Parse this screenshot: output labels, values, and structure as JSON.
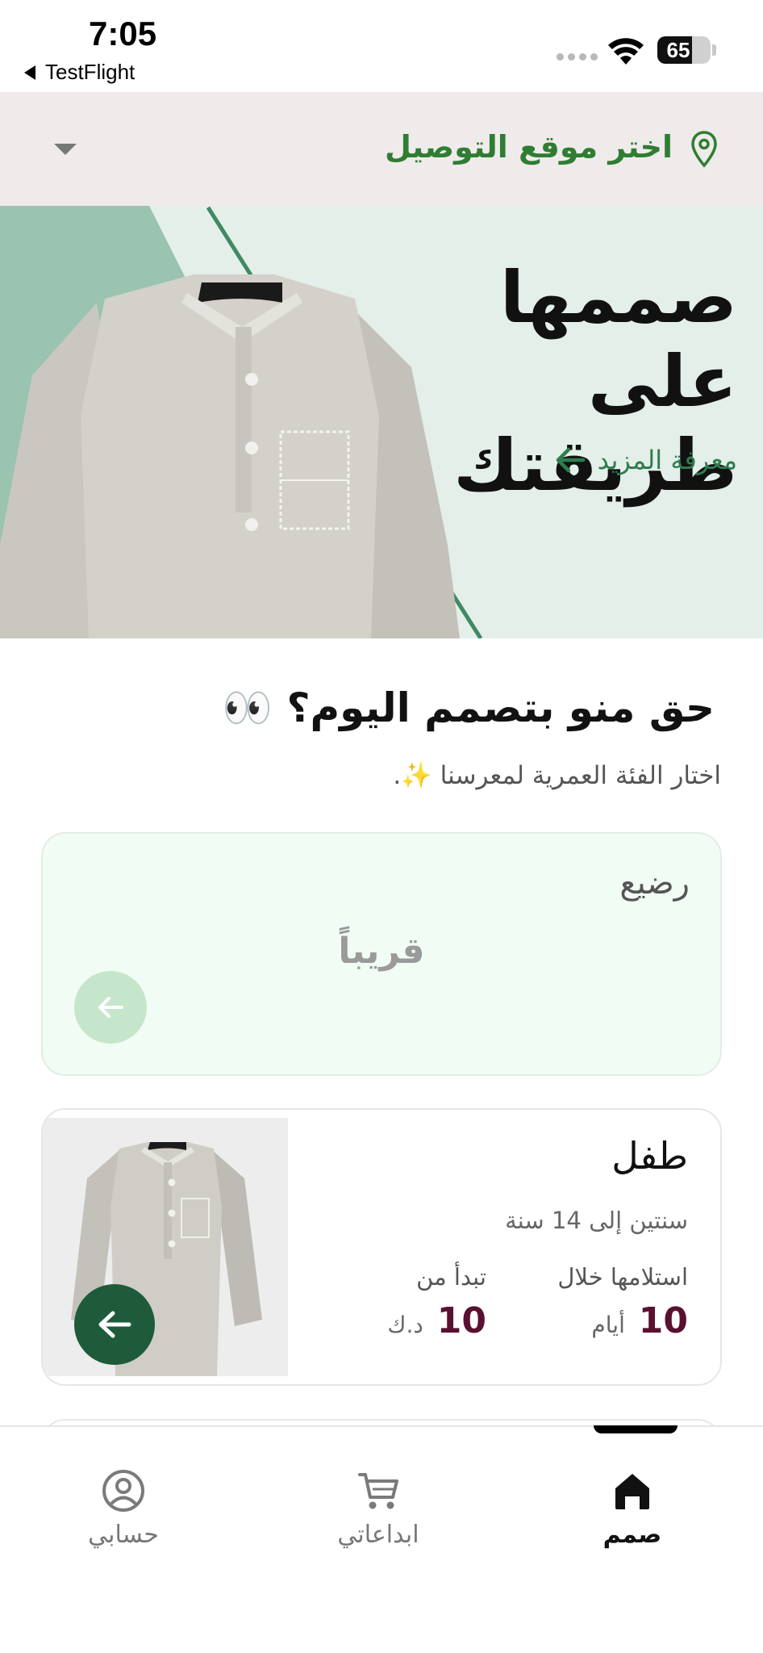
{
  "status_bar": {
    "time": "7:05",
    "back_app": "TestFlight",
    "battery": "65",
    "battery_level": 0.65
  },
  "location": {
    "label": "اختر موقع التوصيل"
  },
  "hero": {
    "title": "صممها على طريقتك",
    "more_label": "معرفة المزيد"
  },
  "section": {
    "title": "حق منو بتصمم اليوم؟ 👀",
    "subtitle": "اختار الفئة العمرية لمعرسنا ✨."
  },
  "categories": [
    {
      "title": "رضيع",
      "status": "قريباً"
    },
    {
      "title": "طفل",
      "age_range": "سنتين إلى 14 سنة",
      "delivery_label": "استلامها خلال",
      "delivery_value": "10",
      "delivery_unit": "أيام",
      "price_label": "تبدأ من",
      "price_value": "10",
      "price_unit": "د.ك"
    }
  ],
  "bottom_nav": {
    "items": [
      {
        "label": "صمم",
        "icon": "home-icon",
        "active": true
      },
      {
        "label": "ابداعاتي",
        "icon": "cart-icon",
        "active": false
      },
      {
        "label": "حسابي",
        "icon": "account-icon",
        "active": false
      }
    ]
  },
  "colors": {
    "accent_green": "#2f7d32",
    "dark_green": "#1d5b3a",
    "price_maroon": "#5a1030",
    "infant_card_bg": "#f1fcf4"
  }
}
